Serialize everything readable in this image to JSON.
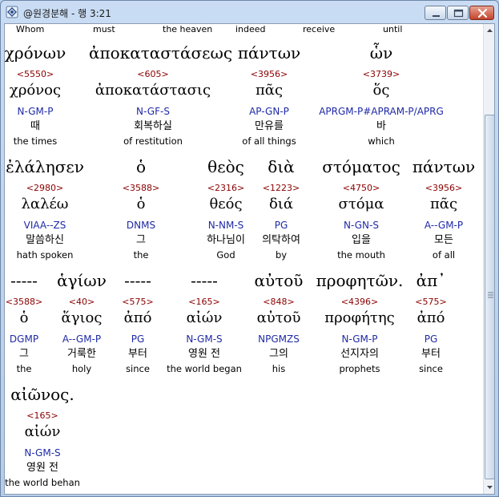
{
  "window": {
    "title": "@원경분해 - 행 3:21"
  },
  "header_words": [
    "Whom",
    "must",
    "the heaven",
    "indeed",
    "receive",
    "until"
  ],
  "rows": [
    [
      {
        "greek": "χρόνων",
        "num": "<5550>",
        "lemma": "χρόνος",
        "parse": "N-GM-P",
        "kor": "때",
        "eng": "the times"
      },
      {
        "greek": "ἀποκαταστάσεως",
        "num": "<605>",
        "lemma": "ἀποκατάστασις",
        "parse": "N-GF-S",
        "kor": "회복하실",
        "eng": "of restitution"
      },
      {
        "greek": "πάντων",
        "num": "<3956>",
        "lemma": "πᾶς",
        "parse": "AP-GN-P",
        "kor": "만유를",
        "eng": "of all things"
      },
      {
        "greek": "ὧν",
        "num": "<3739>",
        "lemma": "ὅς",
        "parse": "APRGM-P#APRAM-P/APRG",
        "kor": "바",
        "eng": "which"
      }
    ],
    [
      {
        "greek": "ἐλάλησεν",
        "num": "<2980>",
        "lemma": "λαλέω",
        "parse": "VIAA--ZS",
        "kor": "말씀하신",
        "eng": "hath spoken"
      },
      {
        "greek": "ὁ",
        "num": "<3588>",
        "lemma": "ὁ",
        "parse": "DNMS",
        "kor": "그",
        "eng": "the"
      },
      {
        "greek": "θεὸς",
        "num": "<2316>",
        "lemma": "θεός",
        "parse": "N-NM-S",
        "kor": "하나님이",
        "eng": "God"
      },
      {
        "greek": "διὰ",
        "num": "<1223>",
        "lemma": "διά",
        "parse": "PG",
        "kor": "의탁하여",
        "eng": "by"
      },
      {
        "greek": "στόματος",
        "num": "<4750>",
        "lemma": "στόμα",
        "parse": "N-GN-S",
        "kor": "입을",
        "eng": "the mouth"
      },
      {
        "greek": "πάντων",
        "num": "<3956>",
        "lemma": "πᾶς",
        "parse": "A--GM-P",
        "kor": "모든",
        "eng": "of all"
      }
    ],
    [
      {
        "greek": "-----",
        "num": "<3588>",
        "lemma": "ὁ",
        "parse": "DGMP",
        "kor": "그",
        "eng": "the"
      },
      {
        "greek": "ἁγίων",
        "num": "<40>",
        "lemma": "ἅγιος",
        "parse": "A--GM-P",
        "kor": "거룩한",
        "eng": "holy"
      },
      {
        "greek": "-----",
        "num": "<575>",
        "lemma": "ἀπό",
        "parse": "PG",
        "kor": "부터",
        "eng": "since"
      },
      {
        "greek": "-----",
        "num": "<165>",
        "lemma": "αἰών",
        "parse": "N-GM-S",
        "kor": "영원 전",
        "eng": "the world began"
      },
      {
        "greek": "αὐτοῦ",
        "num": "<848>",
        "lemma": "αὐτοῦ",
        "parse": "NPGMZS",
        "kor": "그의",
        "eng": "his"
      },
      {
        "greek": "προφητῶν.",
        "num": "<4396>",
        "lemma": "προφήτης",
        "parse": "N-GM-P",
        "kor": "선지자의",
        "eng": "prophets"
      },
      {
        "greek": "ἀπ᾽",
        "num": "<575>",
        "lemma": "ἀπό",
        "parse": "PG",
        "kor": "부터",
        "eng": "since"
      }
    ],
    [
      {
        "greek": "αἰῶνος.",
        "num": "<165>",
        "lemma": "αἰών",
        "parse": "N-GM-S",
        "kor": "영원 전",
        "eng": "the world behan"
      }
    ]
  ]
}
